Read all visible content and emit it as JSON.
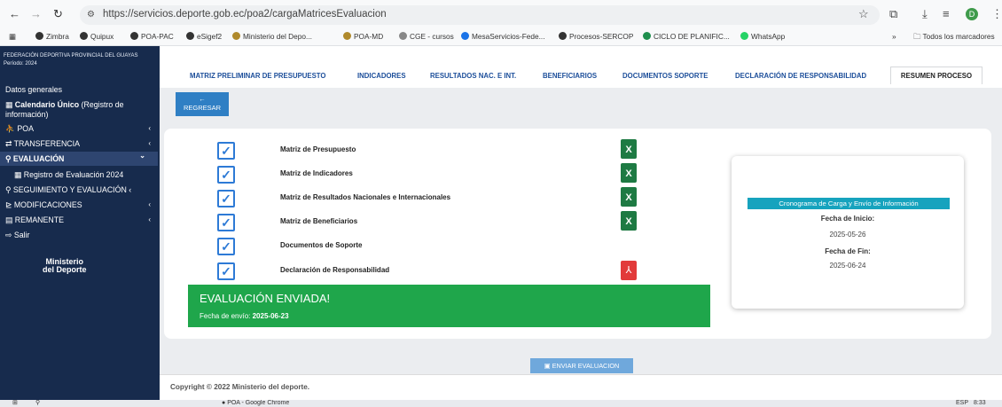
{
  "browser": {
    "url": "https://servicios.deporte.gob.ec/poa2/cargaMatricesEvaluacion",
    "bookmarks": [
      "Zimbra",
      "Quipux",
      "POA-PAC",
      "eSigef2",
      "Ministerio del Depo...",
      "POA-MD",
      "CGE - cursos",
      "MesaServicios-Fede...",
      "Procesos-SERCOP",
      "CICLO DE PLANIFIC...",
      "WhatsApp"
    ],
    "all_bookmarks": "Todos los marcadores",
    "profile_initial": "D"
  },
  "sidebar": {
    "org_name": "FEDERACIÓN DEPORTIVA PROVINCIAL DEL GUAYAS",
    "period": "Período: 2024",
    "datos_generales": "Datos generales",
    "calendario": "Calendario Único",
    "calendario_sub": "(Registro de información)",
    "poa": "POA",
    "transferencia": "TRANSFERENCIA",
    "evaluacion": "EVALUACIÓN",
    "registro": "Registro de Evaluación 2024",
    "seguimiento": "SEGUIMIENTO Y EVALUACIÓN",
    "modificaciones": "MODIFICACIONES",
    "remanente": "REMANENTE",
    "salir": "Salir",
    "logo_line1": "Ministerio",
    "logo_line2": "del Deporte"
  },
  "tabs": [
    "MATRIZ PRELIMINAR DE PRESUPUESTO",
    "INDICADORES",
    "RESULTADOS NAC. E INT.",
    "BENEFICIARIOS",
    "DOCUMENTOS SOPORTE",
    "DECLARACIÓN DE RESPONSABILIDAD",
    "RESUMEN PROCESO"
  ],
  "back_button": "REGRESAR",
  "matrices": [
    {
      "label": "Matriz de Presupuesto",
      "file": "excel-icon"
    },
    {
      "label": "Matriz de Indicadores",
      "file": "excel-icon"
    },
    {
      "label": "Matriz de Resultados Nacionales e Internacionales",
      "file": "excel-icon"
    },
    {
      "label": "Matriz de Beneficiarios",
      "file": "excel-icon"
    },
    {
      "label": "Documentos de Soporte",
      "file": ""
    },
    {
      "label": "Declaración de Responsabilidad",
      "file": "pdf-icon"
    }
  ],
  "sent": {
    "title": "EVALUACIÓN ENVIADA!",
    "date_label": "Fecha de envío:",
    "date_value": "2025-06-23"
  },
  "schedule": {
    "header": "Cronograma de Carga y Envío de Información",
    "start_label": "Fecha de Inicio:",
    "start_value": "2025-05-26",
    "end_label": "Fecha de Fin:",
    "end_value": "2025-06-24"
  },
  "send_button": "ENVIAR EVALUACION",
  "copyright": "Copyright © 2022 Ministerio del deporte.",
  "taskbar": {
    "chrome_window": "POA - Google Chrome",
    "lang": "ESP",
    "time": "8:33"
  },
  "colors": {
    "sidebar_bg": "#172b4d",
    "tab_text": "#1c4e9a",
    "success": "#1fa64b",
    "schedule_header": "#16a3be",
    "back_button": "#2f7fc4"
  }
}
